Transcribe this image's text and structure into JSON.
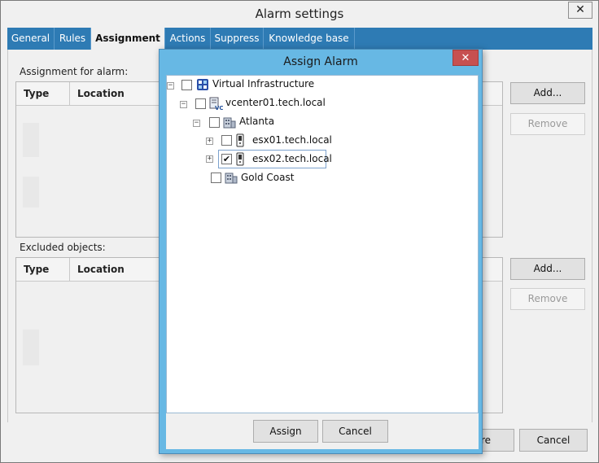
{
  "window": {
    "title": "Alarm settings",
    "close_glyph": "✕"
  },
  "tabs": [
    {
      "label": "General",
      "active": false
    },
    {
      "label": "Rules",
      "active": false
    },
    {
      "label": "Assignment",
      "active": true
    },
    {
      "label": "Actions",
      "active": false
    },
    {
      "label": "Suppress",
      "active": false
    },
    {
      "label": "Knowledge base",
      "active": false
    }
  ],
  "assignment": {
    "section_label": "Assignment for alarm:",
    "columns": [
      "Type",
      "Location"
    ],
    "add_label": "Add...",
    "remove_label": "Remove"
  },
  "excluded": {
    "section_label": "Excluded objects:",
    "columns": [
      "Type",
      "Location"
    ],
    "add_label": "Add...",
    "remove_label": "Remove"
  },
  "footer": {
    "partial_label": "re",
    "cancel_label": "Cancel"
  },
  "modal": {
    "title": "Assign Alarm",
    "close_glyph": "✕",
    "tree": [
      {
        "label": "Virtual Infrastructure",
        "expander": "−",
        "checked": false,
        "icon": "virtual-infrastructure-icon"
      },
      {
        "label": "vcenter01.tech.local",
        "expander": "−",
        "checked": false,
        "icon": "vcenter-icon"
      },
      {
        "label": "Atlanta",
        "expander": "−",
        "checked": false,
        "icon": "datacenter-icon"
      },
      {
        "label": "esx01.tech.local",
        "expander": "+",
        "checked": false,
        "icon": "host-icon"
      },
      {
        "label": "esx02.tech.local",
        "expander": "+",
        "checked": true,
        "icon": "host-icon"
      },
      {
        "label": "Gold Coast",
        "expander": "",
        "checked": false,
        "icon": "datacenter-icon"
      }
    ],
    "check_glyph": "✔",
    "assign_label": "Assign",
    "cancel_label": "Cancel"
  }
}
